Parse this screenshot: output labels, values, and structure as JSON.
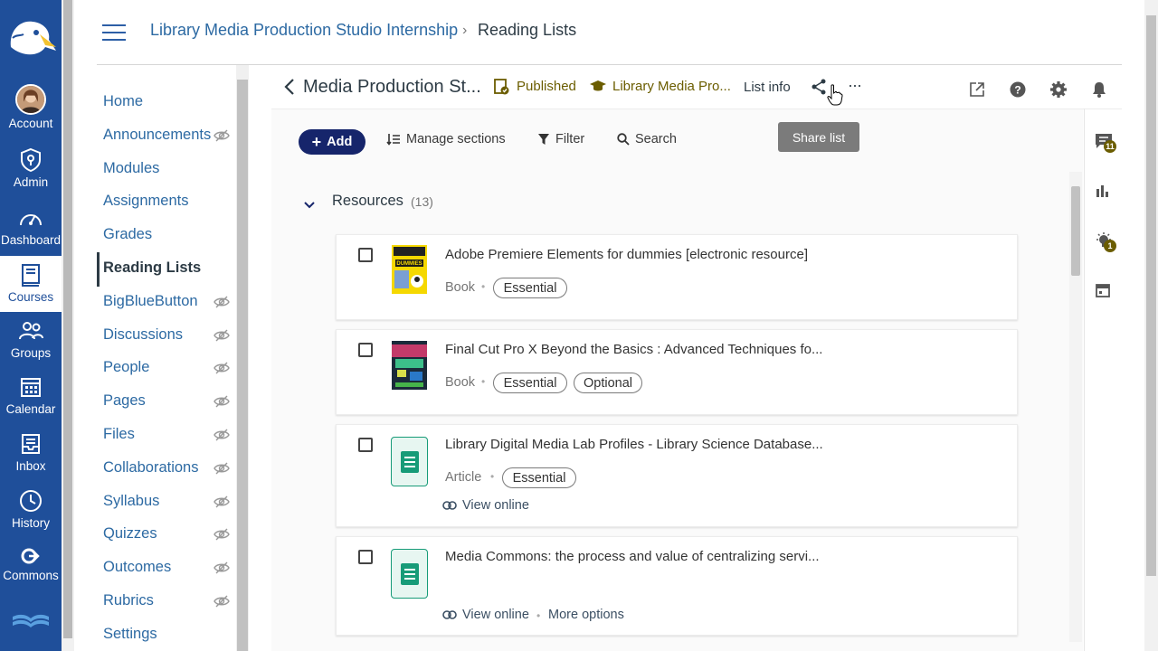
{
  "global_nav": {
    "items": [
      {
        "label": "Account",
        "icon": "avatar"
      },
      {
        "label": "Admin",
        "icon": "shield-icon"
      },
      {
        "label": "Dashboard",
        "icon": "dashboard-icon"
      },
      {
        "label": "Courses",
        "icon": "book-icon"
      },
      {
        "label": "Groups",
        "icon": "groups-icon"
      },
      {
        "label": "Calendar",
        "icon": "calendar-icon"
      },
      {
        "label": "Inbox",
        "icon": "inbox-icon"
      },
      {
        "label": "History",
        "icon": "clock-icon"
      },
      {
        "label": "Commons",
        "icon": "commons-icon"
      }
    ]
  },
  "breadcrumb": {
    "course": "Library Media Production Studio Internship",
    "separator": "›",
    "page": "Reading Lists"
  },
  "course_nav": {
    "items": [
      {
        "label": "Home",
        "hidden": false
      },
      {
        "label": "Announcements",
        "hidden": true
      },
      {
        "label": "Modules",
        "hidden": false
      },
      {
        "label": "Assignments",
        "hidden": false
      },
      {
        "label": "Grades",
        "hidden": false
      },
      {
        "label": "Reading Lists",
        "hidden": false,
        "active": true
      },
      {
        "label": "BigBlueButton",
        "hidden": true
      },
      {
        "label": "Discussions",
        "hidden": true
      },
      {
        "label": "People",
        "hidden": true
      },
      {
        "label": "Pages",
        "hidden": true
      },
      {
        "label": "Files",
        "hidden": true
      },
      {
        "label": "Collaborations",
        "hidden": true
      },
      {
        "label": "Syllabus",
        "hidden": true
      },
      {
        "label": "Quizzes",
        "hidden": true
      },
      {
        "label": "Outcomes",
        "hidden": true
      },
      {
        "label": "Rubrics",
        "hidden": true
      },
      {
        "label": "Settings",
        "hidden": false
      }
    ]
  },
  "list_header": {
    "title": "Media Production St...",
    "status": "Published",
    "course": "Library Media Pro...",
    "list_info": "List info",
    "more": "···"
  },
  "toolbar": {
    "add": "Add",
    "manage_sections": "Manage sections",
    "filter": "Filter",
    "search": "Search",
    "tooltip": "Share list"
  },
  "section": {
    "title": "Resources",
    "count": "(13)"
  },
  "items": [
    {
      "title": "Adobe Premiere Elements for dummies [electronic resource]",
      "type": "Book",
      "tags": [
        "Essential"
      ]
    },
    {
      "title": "Final Cut Pro X Beyond the Basics : Advanced Techniques fo...",
      "type": "Book",
      "tags": [
        "Essential",
        "Optional"
      ]
    },
    {
      "title": "Library Digital Media Lab Profiles - Library Science Database...",
      "type": "Article",
      "tags": [
        "Essential"
      ],
      "link": "View online"
    },
    {
      "title": "Media Commons: the process and value of centralizing servi...",
      "link": "View online",
      "extra_link": "More options"
    }
  ],
  "side_panel": {
    "feedback_count": "11",
    "ideas_count": "1"
  },
  "colors": {
    "global_nav": "#1f4f9a",
    "link": "#2d6aa3",
    "add_button": "#16256b",
    "published": "#6b5d00",
    "doc_icon": "#179b78"
  }
}
